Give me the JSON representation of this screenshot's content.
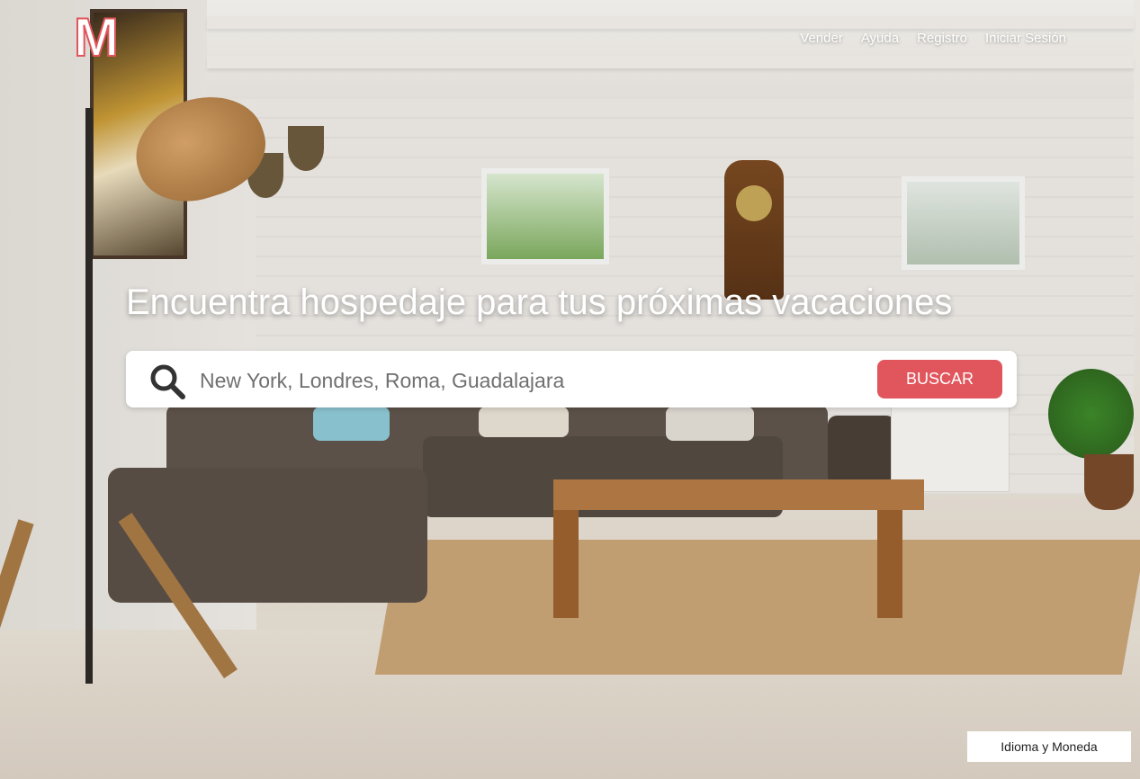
{
  "brand": {
    "logo_letter": "M",
    "accent_color": "#e0565c"
  },
  "nav": {
    "items": [
      {
        "label": "Vender"
      },
      {
        "label": "Ayuda"
      },
      {
        "label": "Registro"
      },
      {
        "label": "Iniciar Sesión"
      }
    ]
  },
  "hero": {
    "headline": "Encuentra hospedaje para tus próximas vacaciones"
  },
  "search": {
    "placeholder": "New York, Londres, Roma, Guadalajara",
    "icon": "search-icon",
    "button_label": "BUSCAR"
  },
  "footer": {
    "language_currency_label": "Idioma y Moneda"
  }
}
